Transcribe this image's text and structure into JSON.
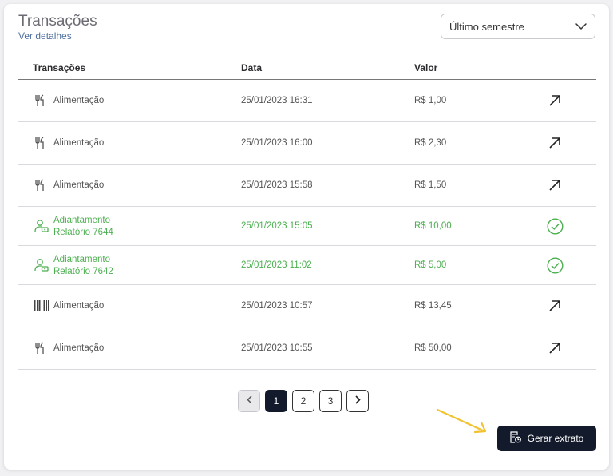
{
  "header": {
    "title": "Transações",
    "details_link": "Ver detalhes",
    "period_select": {
      "value": "Último semestre"
    }
  },
  "table": {
    "columns": [
      "Transações",
      "Data",
      "Valor"
    ],
    "rows": [
      {
        "icon": "fork-knife-icon",
        "name": "Alimentação",
        "date": "25/01/2023 16:31",
        "value": "R$ 1,00",
        "status": "outgoing",
        "action_icon": "arrow-up-right-icon"
      },
      {
        "icon": "fork-knife-icon",
        "name": "Alimentação",
        "date": "25/01/2023 16:00",
        "value": "R$ 2,30",
        "status": "outgoing",
        "action_icon": "arrow-up-right-icon"
      },
      {
        "icon": "fork-knife-icon",
        "name": "Alimentação",
        "date": "25/01/2023 15:58",
        "value": "R$ 1,50",
        "status": "outgoing",
        "action_icon": "arrow-up-right-icon"
      },
      {
        "icon": "person-money-icon",
        "name": "Adiantamento",
        "sub": "Relatório 7644",
        "date": "25/01/2023 15:05",
        "value": "R$ 10,00",
        "status": "approved",
        "action_icon": "check-circle-icon"
      },
      {
        "icon": "person-money-icon",
        "name": "Adiantamento",
        "sub": "Relatório 7642",
        "date": "25/01/2023 11:02",
        "value": "R$ 5,00",
        "status": "approved",
        "action_icon": "check-circle-icon"
      },
      {
        "icon": "barcode-icon",
        "name": "Alimentação",
        "date": "25/01/2023 10:57",
        "value": "R$ 13,45",
        "status": "outgoing",
        "action_icon": "arrow-up-right-icon"
      },
      {
        "icon": "fork-knife-icon",
        "name": "Alimentação",
        "date": "25/01/2023 10:55",
        "value": "R$ 50,00",
        "status": "outgoing",
        "action_icon": "arrow-up-right-icon"
      }
    ]
  },
  "pagination": {
    "pages": [
      "1",
      "2",
      "3"
    ],
    "current": "1"
  },
  "footer": {
    "generate_button": "Gerar extrato"
  },
  "colors": {
    "primary_dark": "#131a2b",
    "success": "#4caf50",
    "link": "#4f6f9e",
    "annotation_arrow": "#f2c230"
  }
}
